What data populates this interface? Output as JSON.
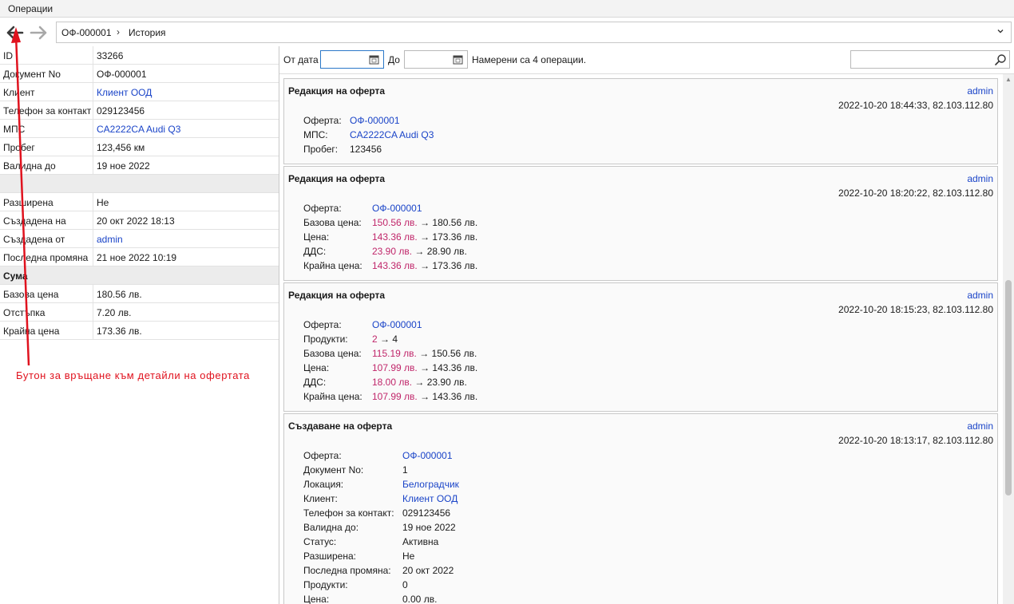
{
  "menubar": {
    "operations": "Операции"
  },
  "breadcrumb": {
    "document": "ОФ-000001",
    "page": "История"
  },
  "details": {
    "rows": [
      {
        "label": "ID",
        "value": "33266",
        "link": false
      },
      {
        "label": "Документ No",
        "value": "ОФ-000001",
        "link": false
      },
      {
        "label": "Клиент",
        "value": "Клиент ООД",
        "link": true
      },
      {
        "label": "Телефон за контакт",
        "value": "029123456",
        "link": false
      },
      {
        "label": "МПС",
        "value": "CA2222CA Audi Q3",
        "link": true
      },
      {
        "label": "Пробег",
        "value": "123,456 км",
        "link": false
      },
      {
        "label": "Валидна до",
        "value": "19 ное 2022",
        "link": false
      },
      {
        "label": "",
        "value": "",
        "header": true
      },
      {
        "label": "Разширена",
        "value": "Не",
        "link": false
      },
      {
        "label": "Създадена на",
        "value": "20 окт 2022 18:13",
        "link": false
      },
      {
        "label": "Създадена от",
        "value": "admin",
        "link": true
      },
      {
        "label": "Последна промяна",
        "value": "21 ное 2022 10:19",
        "link": false
      },
      {
        "label": "Сума",
        "value": "",
        "header": true
      },
      {
        "label": "Базова цена",
        "value": "180.56 лв.",
        "link": false
      },
      {
        "label": "Отстъпка",
        "value": "7.20 лв.",
        "link": false
      },
      {
        "label": "Крайна цена",
        "value": "173.36 лв.",
        "link": false
      }
    ]
  },
  "filters": {
    "from_label": "От дата",
    "to_label": "До",
    "from_value": "",
    "to_value": "",
    "found_text": "Намерени са 4 операции.",
    "search_value": ""
  },
  "operations": [
    {
      "title": "Редакция на оферта",
      "user": "admin",
      "meta": "2022-10-20 18:44:33, 82.103.112.80",
      "fields": [
        {
          "label": "Оферта:",
          "value": "ОФ-000001",
          "link": true
        },
        {
          "label": "МПС:",
          "value": "CA2222CA Audi Q3",
          "link": true
        },
        {
          "label": "Пробег:",
          "value": "123456"
        }
      ]
    },
    {
      "title": "Редакция на оферта",
      "user": "admin",
      "meta": "2022-10-20 18:20:22, 82.103.112.80",
      "fields": [
        {
          "label": "Оферта:",
          "value": "ОФ-000001",
          "link": true
        },
        {
          "label": "Базова цена:",
          "old": "150.56 лв.",
          "new": "180.56 лв."
        },
        {
          "label": "Цена:",
          "old": "143.36 лв.",
          "new": "173.36 лв."
        },
        {
          "label": "ДДС:",
          "old": "23.90 лв.",
          "new": "28.90 лв."
        },
        {
          "label": "Крайна цена:",
          "old": "143.36 лв.",
          "new": "173.36 лв."
        }
      ]
    },
    {
      "title": "Редакция на оферта",
      "user": "admin",
      "meta": "2022-10-20 18:15:23, 82.103.112.80",
      "fields": [
        {
          "label": "Оферта:",
          "value": "ОФ-000001",
          "link": true
        },
        {
          "label": "Продукти:",
          "old": "2",
          "new": "4"
        },
        {
          "label": "Базова цена:",
          "old": "115.19 лв.",
          "new": "150.56 лв."
        },
        {
          "label": "Цена:",
          "old": "107.99 лв.",
          "new": "143.36 лв."
        },
        {
          "label": "ДДС:",
          "old": "18.00 лв.",
          "new": "23.90 лв."
        },
        {
          "label": "Крайна цена:",
          "old": "107.99 лв.",
          "new": "143.36 лв."
        }
      ]
    },
    {
      "title": "Създаване на оферта",
      "user": "admin",
      "meta": "2022-10-20 18:13:17, 82.103.112.80",
      "fields": [
        {
          "label": "Оферта:",
          "value": "ОФ-000001",
          "link": true
        },
        {
          "label": "Документ No:",
          "value": "1"
        },
        {
          "label": "Локация:",
          "value": "Белоградчик",
          "link": true
        },
        {
          "label": "Клиент:",
          "value": "Клиент ООД",
          "link": true
        },
        {
          "label": "Телефон за контакт:",
          "value": "029123456"
        },
        {
          "label": "Валидна до:",
          "value": "19 ное 2022"
        },
        {
          "label": "Статус:",
          "value": "Активна"
        },
        {
          "label": "Разширена:",
          "value": "Не"
        },
        {
          "label": "Последна промяна:",
          "value": "20 окт 2022"
        },
        {
          "label": "Продукти:",
          "value": "0"
        },
        {
          "label": "Цена:",
          "value": "0.00 лв."
        }
      ]
    }
  ],
  "annotation": {
    "text": "Бутон за връщане към детайли на офертата",
    "color": "#e0121e"
  },
  "colors": {
    "link": "#1a44c8",
    "old_value": "#c0266a",
    "annotation": "#e0121e"
  },
  "icons": [
    "back-arrow-icon",
    "forward-arrow-icon",
    "chevron-down-icon",
    "calendar-icon",
    "search-icon"
  ]
}
